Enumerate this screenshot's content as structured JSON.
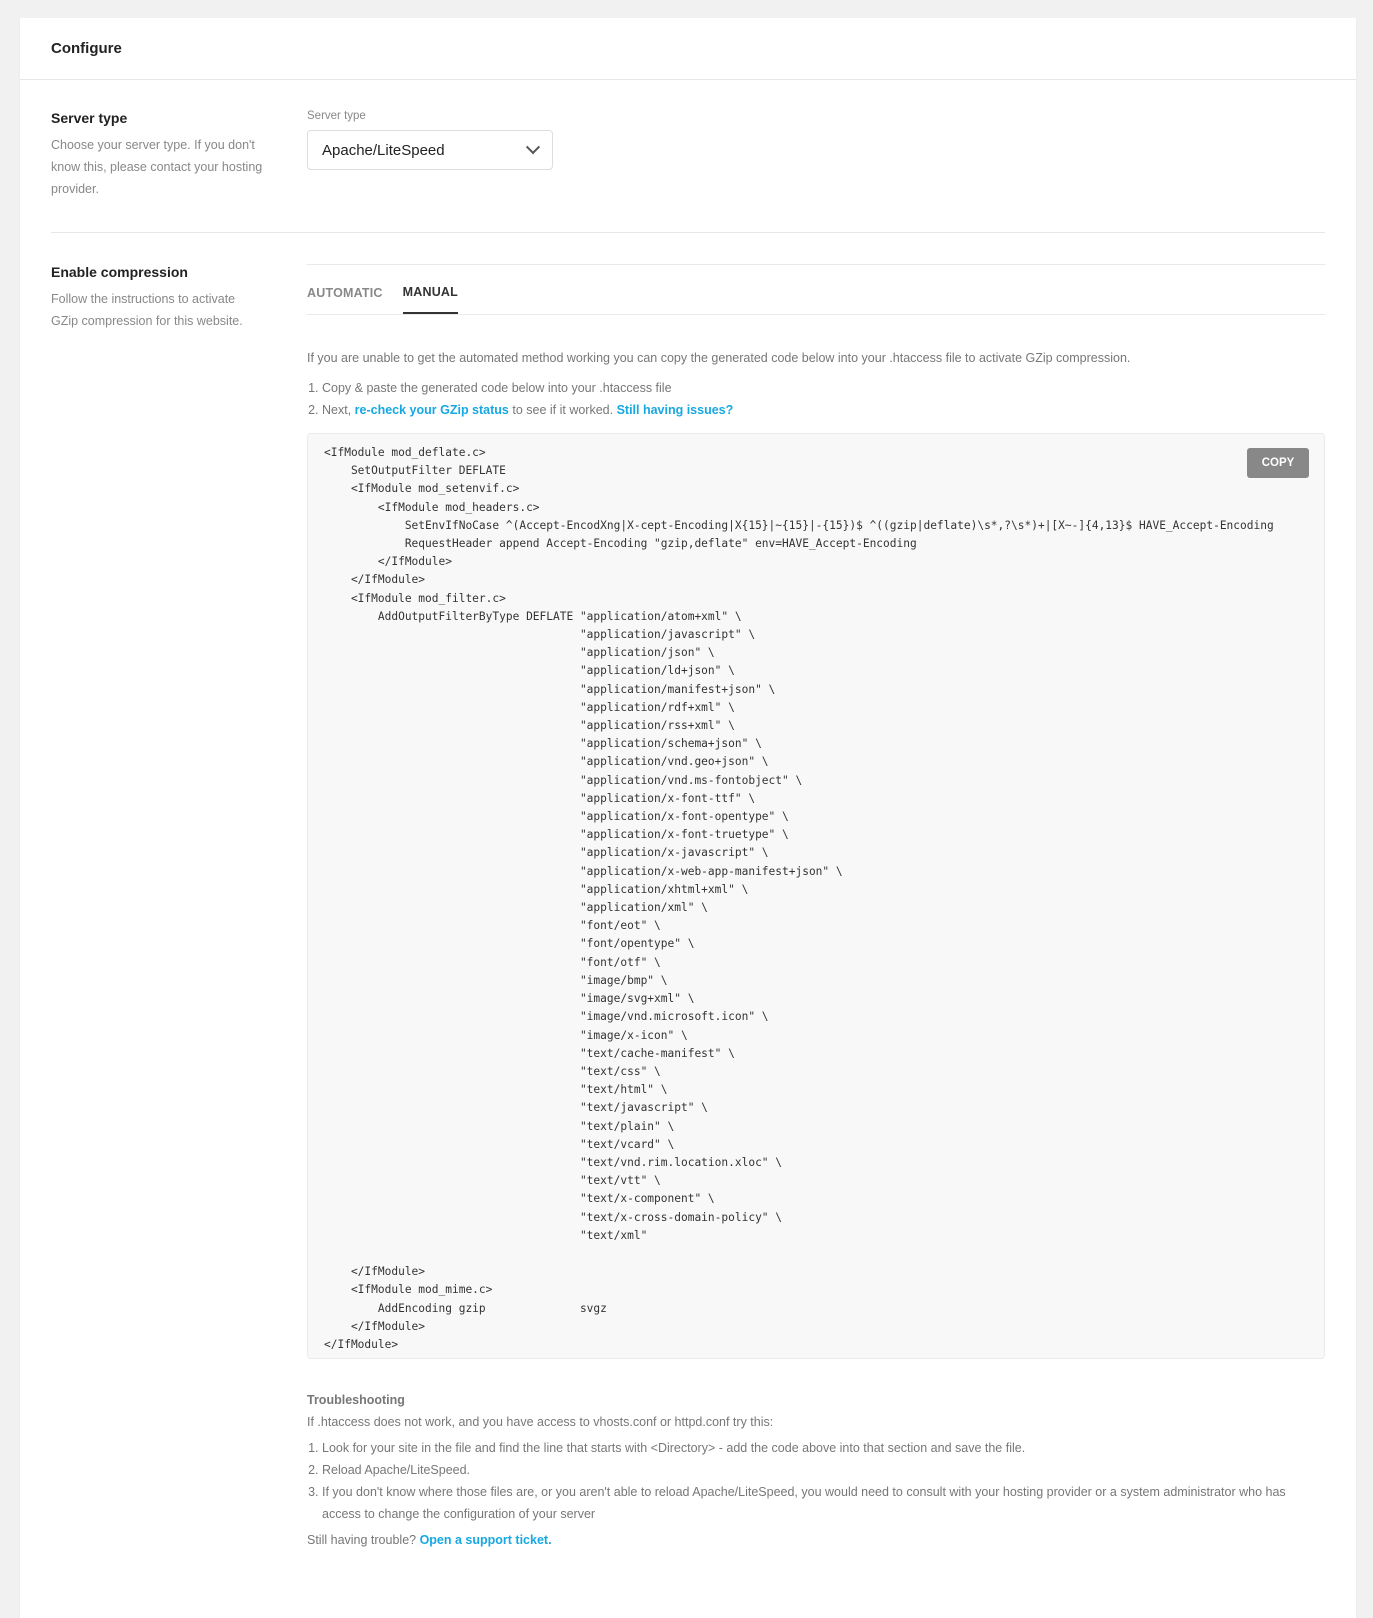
{
  "header": {
    "title": "Configure"
  },
  "server_type": {
    "title": "Server type",
    "description": "Choose your server type. If you don't know this, please contact your hosting provider.",
    "field_label": "Server type",
    "selected": "Apache/LiteSpeed"
  },
  "compression": {
    "title": "Enable compression",
    "description": "Follow the instructions to activate GZip compression for this website.",
    "tabs": [
      {
        "label": "AUTOMATIC",
        "active": false
      },
      {
        "label": "MANUAL",
        "active": true
      }
    ],
    "intro": "If you are unable to get the automated method working you can copy the generated code below into your .htaccess file to activate GZip compression.",
    "step1": "Copy & paste the generated code below into your .htaccess file",
    "step2_prefix": "Next, ",
    "step2_link": "re-check your GZip status",
    "step2_middle": " to see if it worked. ",
    "step2_link2": "Still having issues?",
    "copy_label": "COPY",
    "code": "<IfModule mod_deflate.c>\n    SetOutputFilter DEFLATE\n    <IfModule mod_setenvif.c>\n        <IfModule mod_headers.c>\n            SetEnvIfNoCase ^(Accept-EncodXng|X-cept-Encoding|X{15}|~{15}|-{15})$ ^((gzip|deflate)\\s*,?\\s*)+|[X~-]{4,13}$ HAVE_Accept-Encoding\n            RequestHeader append Accept-Encoding \"gzip,deflate\" env=HAVE_Accept-Encoding\n        </IfModule>\n    </IfModule>\n    <IfModule mod_filter.c>\n        AddOutputFilterByType DEFLATE \"application/atom+xml\" \\\n                                      \"application/javascript\" \\\n                                      \"application/json\" \\\n                                      \"application/ld+json\" \\\n                                      \"application/manifest+json\" \\\n                                      \"application/rdf+xml\" \\\n                                      \"application/rss+xml\" \\\n                                      \"application/schema+json\" \\\n                                      \"application/vnd.geo+json\" \\\n                                      \"application/vnd.ms-fontobject\" \\\n                                      \"application/x-font-ttf\" \\\n                                      \"application/x-font-opentype\" \\\n                                      \"application/x-font-truetype\" \\\n                                      \"application/x-javascript\" \\\n                                      \"application/x-web-app-manifest+json\" \\\n                                      \"application/xhtml+xml\" \\\n                                      \"application/xml\" \\\n                                      \"font/eot\" \\\n                                      \"font/opentype\" \\\n                                      \"font/otf\" \\\n                                      \"image/bmp\" \\\n                                      \"image/svg+xml\" \\\n                                      \"image/vnd.microsoft.icon\" \\\n                                      \"image/x-icon\" \\\n                                      \"text/cache-manifest\" \\\n                                      \"text/css\" \\\n                                      \"text/html\" \\\n                                      \"text/javascript\" \\\n                                      \"text/plain\" \\\n                                      \"text/vcard\" \\\n                                      \"text/vnd.rim.location.xloc\" \\\n                                      \"text/vtt\" \\\n                                      \"text/x-component\" \\\n                                      \"text/x-cross-domain-policy\" \\\n                                      \"text/xml\"\n\n    </IfModule>\n    <IfModule mod_mime.c>\n        AddEncoding gzip              svgz\n    </IfModule>\n</IfModule>"
  },
  "troubleshooting": {
    "title": "Troubleshooting",
    "intro": "If .htaccess does not work, and you have access to vhosts.conf or httpd.conf try this:",
    "items": [
      "Look for your site in the file and find the line that starts with <Directory> - add the code above into that section and save the file.",
      "Reload Apache/LiteSpeed.",
      "If you don't know where those files are, or you aren't able to reload Apache/LiteSpeed, you would need to consult with your hosting provider or a system administrator who has access to change the configuration of your server"
    ],
    "still_prefix": "Still having trouble? ",
    "still_link": "Open a support ticket."
  }
}
